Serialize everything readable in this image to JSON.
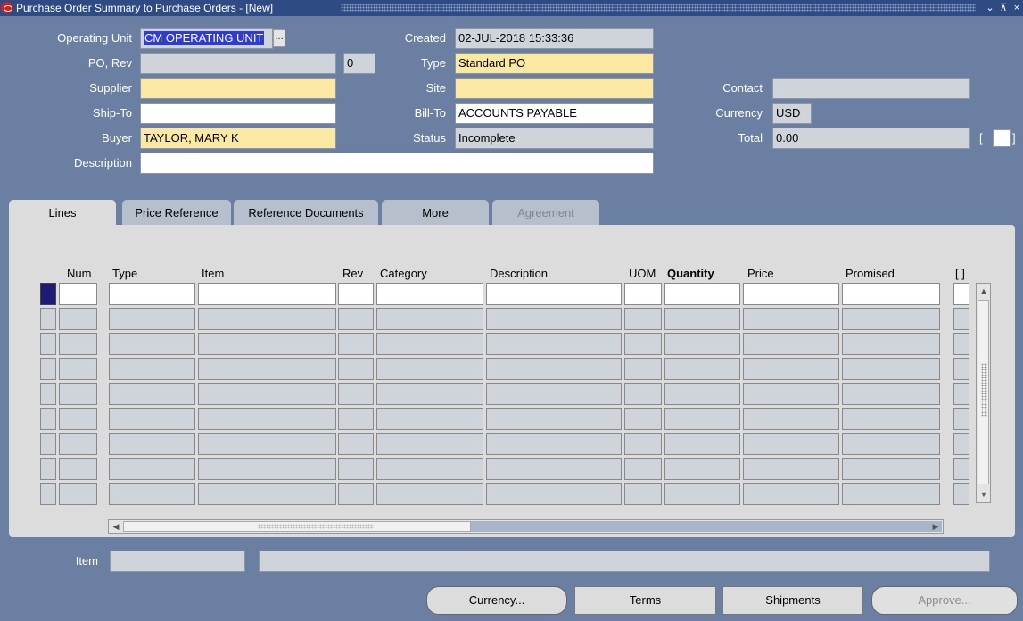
{
  "window": {
    "title": "Purchase Order Summary to Purchase Orders - [New]",
    "controls": {
      "minimize": "⌄",
      "maximize": "⊼",
      "close": "×"
    }
  },
  "header": {
    "operating_unit": {
      "label": "Operating Unit",
      "value": "CM OPERATING UNIT"
    },
    "po_rev": {
      "label": "PO, Rev",
      "value": "",
      "rev": "0"
    },
    "supplier": {
      "label": "Supplier",
      "value": ""
    },
    "ship_to": {
      "label": "Ship-To",
      "value": ""
    },
    "buyer": {
      "label": "Buyer",
      "value": "TAYLOR, MARY K"
    },
    "description": {
      "label": "Description",
      "value": ""
    },
    "created": {
      "label": "Created",
      "value": "02-JUL-2018 15:33:36"
    },
    "type": {
      "label": "Type",
      "value": "Standard PO"
    },
    "site": {
      "label": "Site",
      "value": ""
    },
    "bill_to": {
      "label": "Bill-To",
      "value": "ACCOUNTS PAYABLE"
    },
    "status": {
      "label": "Status",
      "value": "Incomplete"
    },
    "contact": {
      "label": "Contact",
      "value": ""
    },
    "currency": {
      "label": "Currency",
      "value": "USD"
    },
    "total": {
      "label": "Total",
      "value": "0.00"
    },
    "dff_bracket_open": "[",
    "dff_bracket_close": "]"
  },
  "tabs": [
    {
      "label": "Lines",
      "state": "active"
    },
    {
      "label": "Price Reference",
      "state": "inactive"
    },
    {
      "label": "Reference Documents",
      "state": "inactive"
    },
    {
      "label": "More",
      "state": "inactive"
    },
    {
      "label": "Agreement",
      "state": "disabled"
    }
  ],
  "lines_table": {
    "columns": [
      "Num",
      "Type",
      "Item",
      "Rev",
      "Category",
      "Description",
      "UOM",
      "Quantity",
      "Price",
      "Promised",
      "[ ]"
    ],
    "row_count": 9
  },
  "item_footer": {
    "label": "Item",
    "value": "",
    "description": ""
  },
  "buttons": {
    "currency": "Currency...",
    "terms": "Terms",
    "shipments": "Shipments",
    "approve": "Approve..."
  },
  "colors": {
    "background": "#6b7fa3",
    "titlebar": "#2f4b84",
    "required_field": "#fbe8a3",
    "readonly_field": "#cfd3da",
    "selected_text": "#2e3bd6"
  }
}
